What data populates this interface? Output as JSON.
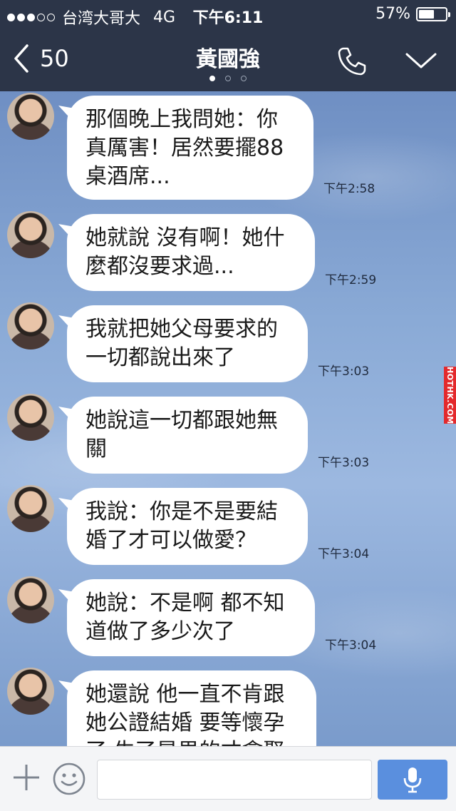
{
  "status_bar": {
    "carrier": "台湾大哥大",
    "network": "4G",
    "time": "下午6:11",
    "battery_percent": "57%",
    "battery_level": 0.57,
    "signal_bars_filled": 3,
    "signal_bars_total": 5
  },
  "header": {
    "back_count": "50",
    "title": "黃國強",
    "page_dots": 3,
    "active_dot": 0
  },
  "messages": [
    {
      "text": "那個晚上我問她：你\n真厲害！居然要擺88\n桌酒席...",
      "time": "下午2:58"
    },
    {
      "text": "她就說 沒有啊！她什\n麼都沒要求過...",
      "time": "下午2:59"
    },
    {
      "text": "我就把她父母要求的\n一切都說出來了",
      "time": "下午3:03"
    },
    {
      "text": "她說這一切都跟她無\n關",
      "time": "下午3:03"
    },
    {
      "text": "我說：你是不是要結\n婚了才可以做愛？",
      "time": "下午3:04"
    },
    {
      "text": "她說：不是啊 都不知\n道做了多少次了",
      "time": "下午3:04"
    },
    {
      "text": "她還說 他一直不肯跟\n她公證結婚 要等懷孕\n了 生了是男的才會娶",
      "time": ""
    }
  ],
  "watermark": "HOTHK.COM",
  "input": {
    "placeholder": "",
    "value": ""
  },
  "colors": {
    "header_bg": "#2c3548",
    "send_button": "#5a8fde",
    "watermark_bg": "#e3292c"
  },
  "icons": {
    "back": "chevron-left-icon",
    "call": "phone-icon",
    "menu": "chevron-down-icon",
    "plus": "plus-icon",
    "emoji": "smiley-icon",
    "mic": "microphone-icon"
  }
}
